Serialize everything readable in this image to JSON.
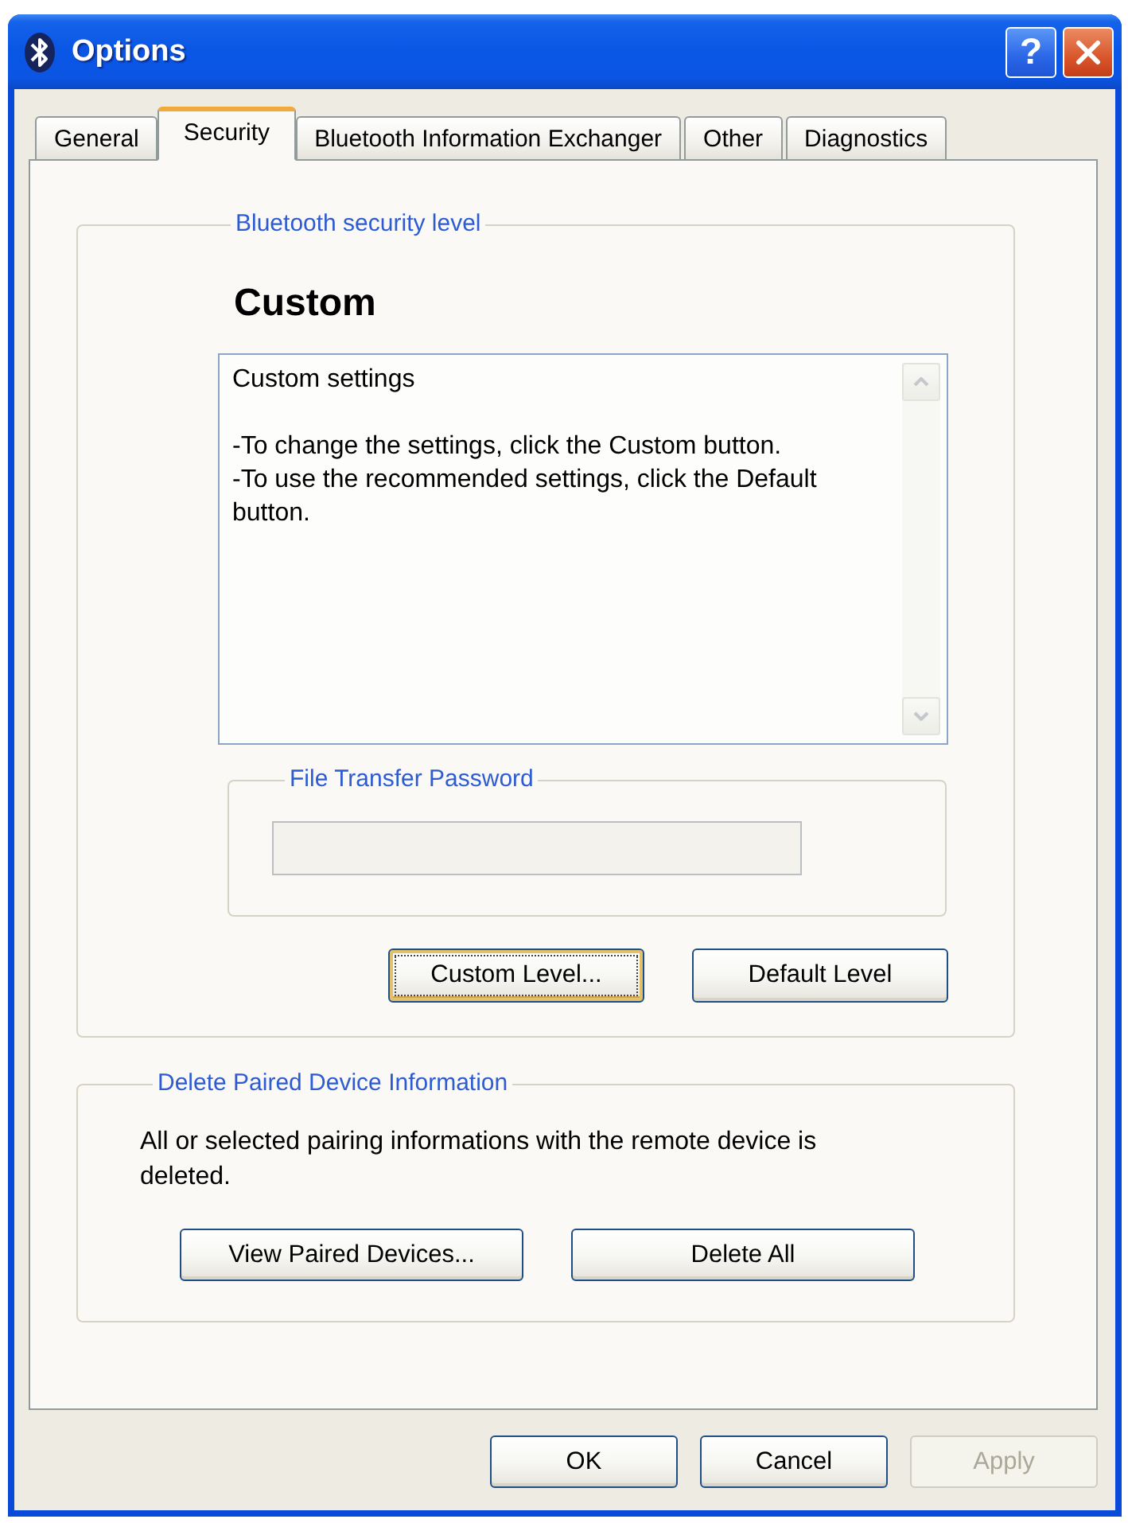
{
  "window": {
    "title": "Options",
    "help_button": "?"
  },
  "tabs": [
    {
      "label": "General",
      "selected": false
    },
    {
      "label": "Security",
      "selected": true
    },
    {
      "label": "Bluetooth Information Exchanger",
      "selected": false
    },
    {
      "label": "Other",
      "selected": false
    },
    {
      "label": "Diagnostics",
      "selected": false
    }
  ],
  "security_level": {
    "label": "Bluetooth security level",
    "level_name": "Custom",
    "description": {
      "heading": "Custom settings",
      "lines": [
        "-To change the settings, click the Custom button.",
        "-To use the recommended settings, click the Default button."
      ]
    },
    "password": {
      "label": "File Transfer Password",
      "field": {
        "disabled": true
      }
    },
    "buttons": [
      {
        "label": "Custom Level...",
        "focused": true
      },
      {
        "label": "Default Level",
        "focused": false
      }
    ]
  },
  "paired_devices": {
    "label": "Delete Paired Device Information",
    "description": "All or selected pairing informations with the remote device is deleted.",
    "buttons": [
      {
        "label": "View Paired Devices..."
      },
      {
        "label": "Delete All"
      }
    ]
  },
  "dialog_buttons": [
    {
      "label": "OK",
      "disabled": false
    },
    {
      "label": "Cancel",
      "disabled": false
    },
    {
      "label": "Apply",
      "disabled": true
    }
  ]
}
